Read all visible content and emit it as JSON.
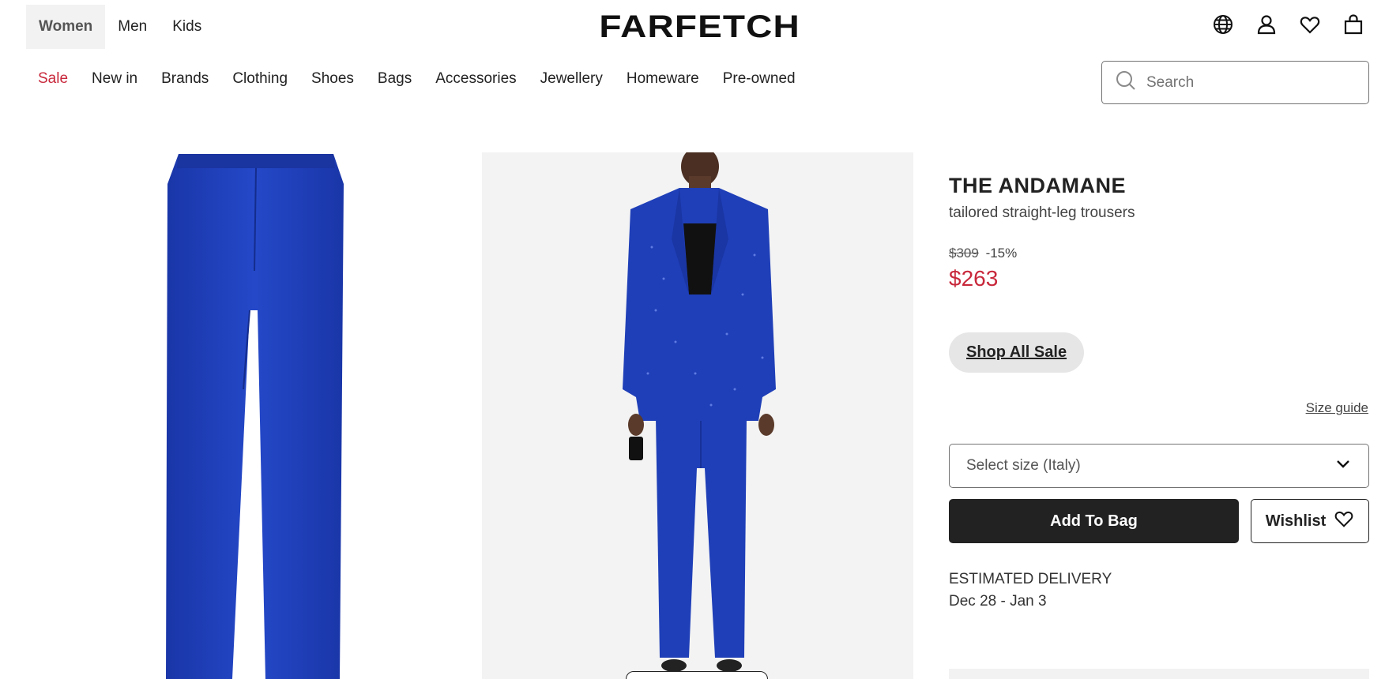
{
  "header": {
    "gender_tabs": [
      {
        "label": "Women",
        "active": true
      },
      {
        "label": "Men",
        "active": false
      },
      {
        "label": "Kids",
        "active": false
      }
    ],
    "logo": "FARFETCH",
    "icons": [
      "globe-icon",
      "account-icon",
      "heart-icon",
      "bag-icon"
    ]
  },
  "nav": {
    "items": [
      "Sale",
      "New in",
      "Brands",
      "Clothing",
      "Shoes",
      "Bags",
      "Accessories",
      "Jewellery",
      "Homeware",
      "Pre-owned"
    ]
  },
  "search": {
    "placeholder": "Search",
    "value": ""
  },
  "product": {
    "brand": "THE ANDAMANE",
    "description": "tailored straight-leg trousers",
    "original_price": "$309",
    "discount": "-15%",
    "sale_price": "$263",
    "shop_sale_label": "Shop All Sale",
    "size_guide_label": "Size guide",
    "size_select_placeholder": "Select size (Italy)",
    "add_to_bag_label": "Add To Bag",
    "wishlist_label": "Wishlist",
    "delivery_title": "ESTIMATED DELIVERY",
    "delivery_dates": "Dec 28 - Jan 3"
  },
  "colors": {
    "sale_red": "#c8283b",
    "primary_dark": "#222222",
    "product_blue": "#1f3fb8"
  }
}
